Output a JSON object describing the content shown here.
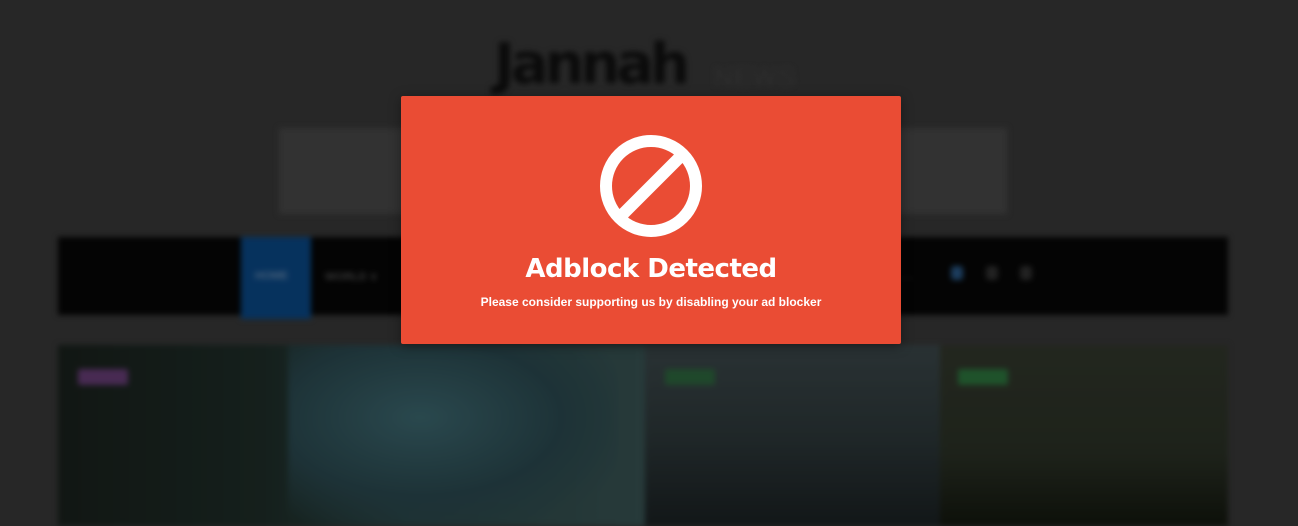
{
  "site": {
    "logo": "Jannah",
    "logo_sub": "NEWS",
    "nav": {
      "home": "HOME",
      "world": "WORLD ∨",
      "right_label": "....."
    }
  },
  "modal": {
    "icon": "prohibited-icon",
    "title": "Adblock Detected",
    "message": "Please consider supporting us by disabling your ad blocker"
  },
  "colors": {
    "modal_bg": "#ea4c34",
    "overlay": "#3a3a3a",
    "nav_bg": "#060606",
    "home_bg": "#0a4a8a"
  }
}
